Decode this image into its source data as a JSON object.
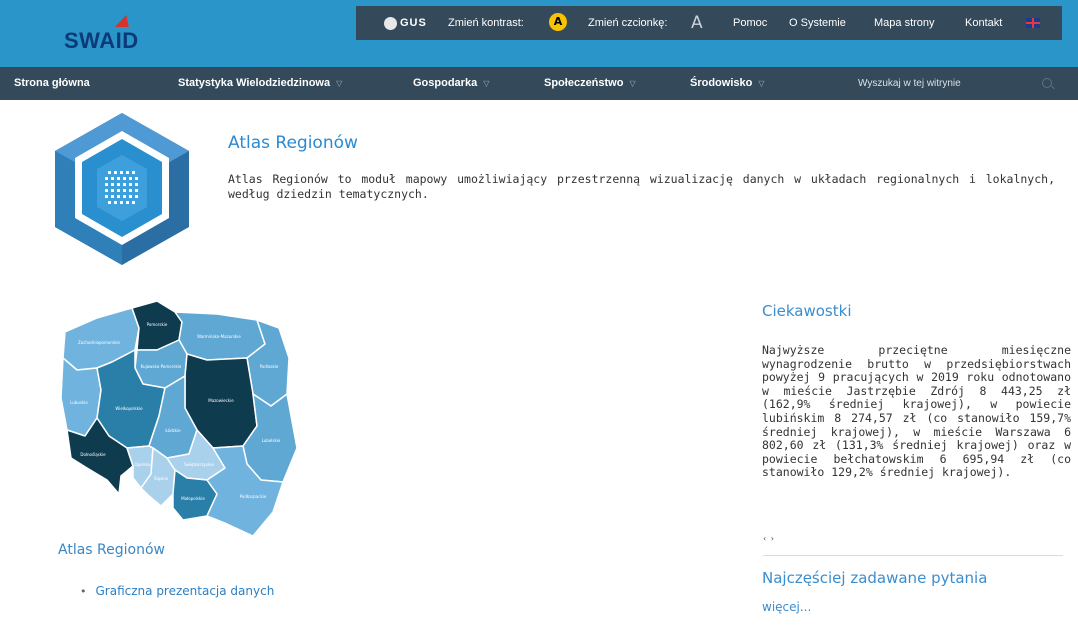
{
  "header": {
    "logo_text": "SWAID",
    "gus_label": "GUS",
    "contrast_label": "Zmień kontrast:",
    "contrast_badge": "A",
    "font_label": "Zmień czcionkę:",
    "font_glyph": "A",
    "links": [
      "Pomoc",
      "O Systemie",
      "Mapa strony",
      "Kontakt"
    ]
  },
  "nav": {
    "items": [
      "Strona główna",
      "Statystyka Wielodziedzinowa",
      "Gospodarka",
      "Społeczeństwo",
      "Środowisko"
    ],
    "search_placeholder": "Wyszukaj w tej witrynie"
  },
  "intro": {
    "title": "Atlas Regionów",
    "text": "Atlas Regionów to moduł mapowy umożliwiający przestrzenną wizualizację danych w układach regionalnych i lokalnych, według dziedzin tematycznych."
  },
  "map": {
    "regions": [
      "Pomorskie",
      "Zachodniopomorskie",
      "Warmińsko-Mazurskie",
      "Kujawsko-Pomorskie",
      "Podlaskie",
      "Lubuskie",
      "Wielkopolskie",
      "Mazowieckie",
      "Łódzkie",
      "Lubelskie",
      "Dolnośląskie",
      "Opolskie",
      "Śląskie",
      "Świętokrzyskie",
      "Małopolskie",
      "Podkarpackie"
    ]
  },
  "left": {
    "title": "Atlas Regionów",
    "links": [
      "Graficzna prezentacja danych"
    ]
  },
  "sidebar": {
    "title": "Ciekawostki",
    "text": "Najwyższe przeciętne miesięczne wynagrodzenie brutto w przedsiębiorstwach powyżej 9 pracujących w 2019 roku odnotowano w mieście Jastrzębie Zdrój 8 443,25 zł (162,9% średniej krajowej), w powiecie lubińskim 8 274,57 zł (co stanowiło 159,7% średniej krajowej), w mieście Warszawa 6 802,60 zł (131,3% średniej krajowej) oraz w powiecie bełchatowskim 6 695,94 zł (co stanowiło 129,2% średniej krajowej).",
    "arrows": "‹ ›",
    "faq_title": "Najczęściej zadawane pytania",
    "more": "więcej..."
  },
  "colors": {
    "header_bg": "#2a95c8",
    "bar_dark": "#34495a",
    "link_blue": "#3a8dd0",
    "map_dark": "#0f3b4f",
    "map_mid": "#2a7fa8",
    "map_light": "#5fa8d3",
    "map_pale": "#a9d1ec"
  }
}
